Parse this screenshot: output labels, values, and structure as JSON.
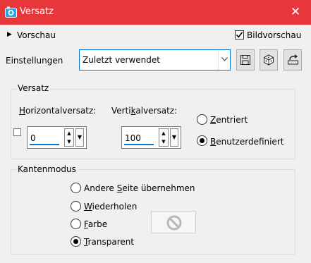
{
  "window": {
    "title": "Versatz",
    "close_icon": "close-icon"
  },
  "preview": {
    "toggle_label": "Vorschau",
    "checkbox_label": "Bildvorschau",
    "checked": true
  },
  "settings": {
    "label": "Einstellungen",
    "value": "Zuletzt verwendet",
    "buttons": [
      "save-icon",
      "dice-icon",
      "reset-icon"
    ]
  },
  "offset": {
    "group_label": "Versatz",
    "horizontal": {
      "label_pre": "",
      "label_u": "H",
      "label_post": "orizontalversatz:",
      "value": "0"
    },
    "vertical": {
      "label_pre": "Verti",
      "label_u": "k",
      "label_post": "alversatz:",
      "value": "100"
    },
    "centered": {
      "label_pre": "",
      "label_u": "Z",
      "label_post": "entriert",
      "selected": false
    },
    "custom": {
      "label_pre": "",
      "label_u": "B",
      "label_post": "enutzerdefiniert",
      "selected": true
    }
  },
  "edge_mode": {
    "group_label": "Kantenmodus",
    "options": [
      {
        "pre": "Andere ",
        "u": "S",
        "post": "eite übernehmen",
        "selected": false
      },
      {
        "pre": "",
        "u": "W",
        "post": "iederholen",
        "selected": false
      },
      {
        "pre": "",
        "u": "F",
        "post": "arbe",
        "selected": false
      },
      {
        "pre": "",
        "u": "T",
        "post": "ransparent",
        "selected": true
      }
    ],
    "color_icon": "no-color-icon"
  }
}
